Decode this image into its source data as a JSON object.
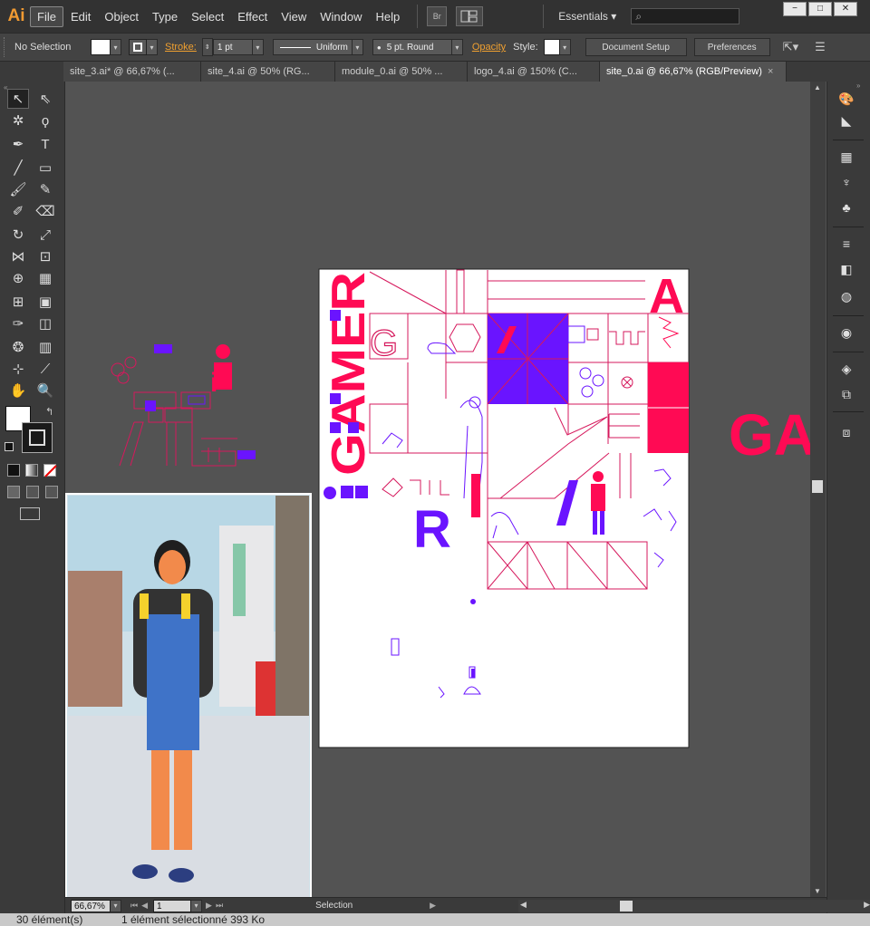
{
  "app": {
    "logo": "Ai",
    "menus": [
      "File",
      "Edit",
      "Object",
      "Type",
      "Select",
      "Effect",
      "View",
      "Window",
      "Help"
    ],
    "active_menu": "File",
    "bridge_label": "Br",
    "workspace": "Essentials",
    "window_controls": [
      "−",
      "□",
      "✕"
    ]
  },
  "control_bar": {
    "selection_state": "No Selection",
    "stroke_label": "Stroke:",
    "stroke_weight": "1 pt",
    "profile": "Uniform",
    "brush": "5 pt. Round",
    "opacity_label": "Opacity",
    "style_label": "Style:",
    "document_setup": "Document Setup",
    "preferences": "Preferences"
  },
  "tabs": [
    {
      "label": "site_3.ai* @ 66,67% (...",
      "active": false
    },
    {
      "label": "site_4.ai @ 50% (RG...",
      "active": false
    },
    {
      "label": "module_0.ai @ 50% ...",
      "active": false
    },
    {
      "label": "logo_4.ai @ 150% (C...",
      "active": false
    },
    {
      "label": "site_0.ai @ 66,67% (RGB/Preview)",
      "active": true
    }
  ],
  "artboard": {
    "big_letter_a": "A",
    "letter_g": "G",
    "letter_r": "R",
    "offside_text": "GA",
    "vertical_word": "GAMER",
    "logo_i": "i"
  },
  "status_bar": {
    "zoom": "66,67%",
    "artboard_number": "1",
    "tool_status": "Selection"
  },
  "app_status": {
    "elements": "30 élément(s)",
    "selected": "1 élément sélectionné 393 Ko"
  },
  "colors": {
    "accent_pink": "#ff0a54",
    "accent_violet": "#6a14ff",
    "ui_orange": "#f09a32"
  }
}
